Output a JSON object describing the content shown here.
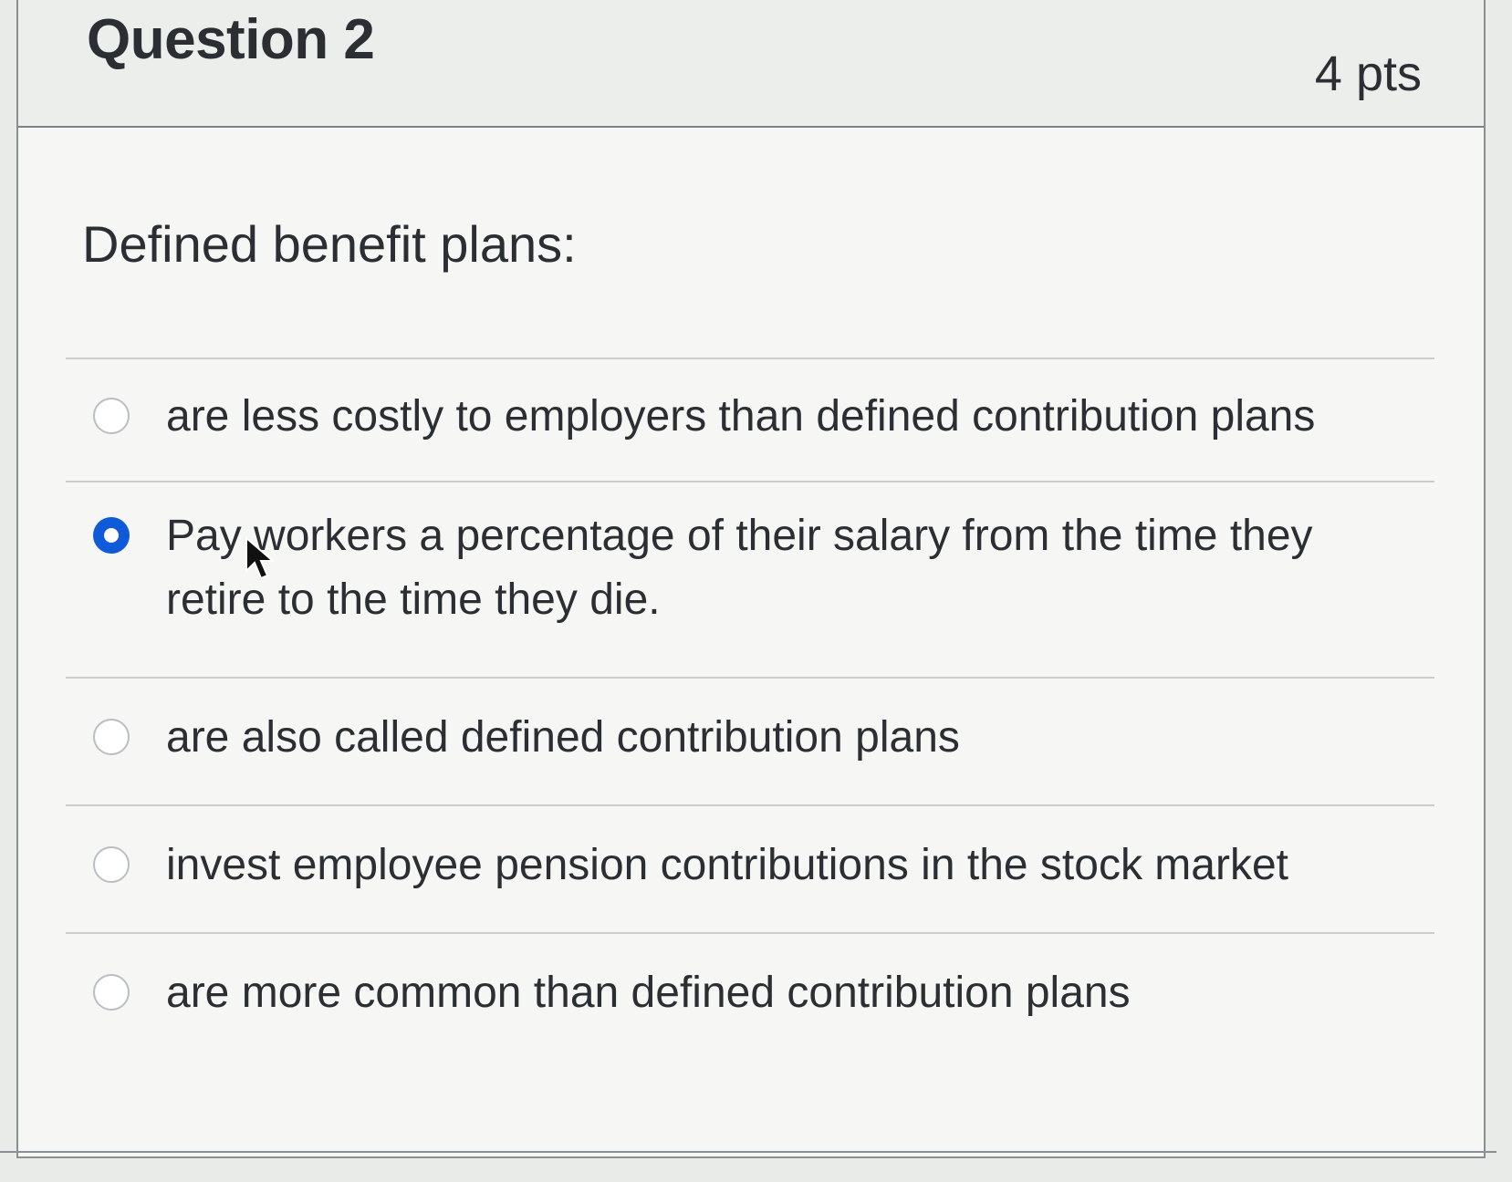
{
  "question": {
    "title": "Question 2",
    "points": "4 pts",
    "prompt": "Defined benefit plans:"
  },
  "answers": [
    {
      "label": "are less costly to employers than defined contribution plans",
      "selected": false
    },
    {
      "label": "Pay workers a percentage of their salary from the time they retire to the time they die.",
      "selected": true
    },
    {
      "label": "are also called defined contribution plans",
      "selected": false
    },
    {
      "label": "invest employee pension contributions in the stock market",
      "selected": false
    },
    {
      "label": "are more common than defined contribution plans",
      "selected": false
    }
  ],
  "colors": {
    "selected_radio": "#0f5ad8",
    "text": "#2b2f33"
  }
}
